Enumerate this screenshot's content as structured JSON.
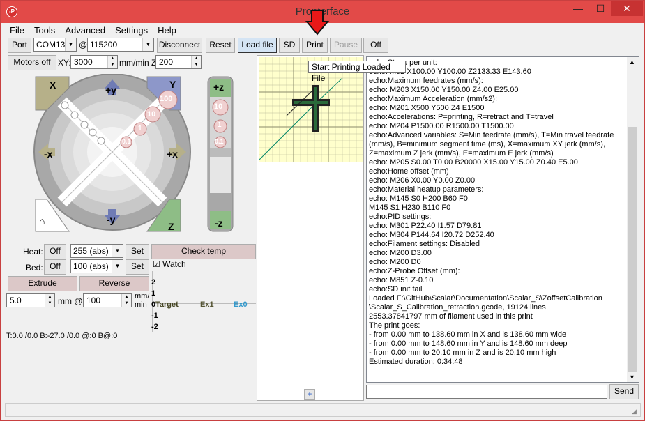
{
  "window": {
    "title": "Pronterface",
    "icon_text": "-P",
    "min": "—",
    "max": "☐",
    "close": "✕"
  },
  "menu": [
    "File",
    "Tools",
    "Advanced",
    "Settings",
    "Help"
  ],
  "toolbar": {
    "port_label": "Port",
    "port_value": "COM13",
    "at": "@",
    "baud_value": "115200",
    "disconnect": "Disconnect",
    "reset": "Reset",
    "load_file": "Load file",
    "sd": "SD",
    "print": "Print",
    "pause": "Pause",
    "off": "Off"
  },
  "tooltip": "Start Printing Loaded File",
  "motor": {
    "motors_off": "Motors off",
    "xy_label": "XY:",
    "xy_value": "3000",
    "units_label": "mm/min Z:",
    "z_value": "200"
  },
  "jog": {
    "home_x": "X",
    "home_y": "Y",
    "home_z": "Z",
    "plus_y": "+y",
    "minus_y": "-y",
    "plus_x": "+x",
    "minus_x": "-x",
    "plus_z": "+z",
    "minus_z": "-z",
    "steps": [
      "100",
      "10",
      "1",
      "0.1"
    ],
    "z_steps": [
      "10",
      "1",
      "0.1"
    ]
  },
  "temp": {
    "heat_label": "Heat:",
    "heat_off": "Off",
    "heat_value": "255 (abs)",
    "heat_set": "Set",
    "bed_label": "Bed:",
    "bed_off": "Off",
    "bed_value": "100 (abs)",
    "bed_set": "Set",
    "check_temp": "Check temp",
    "watch": "Watch"
  },
  "extrude": {
    "extrude": "Extrude",
    "reverse": "Reverse",
    "length": "5.0",
    "mm_at": "mm @",
    "speed": "100",
    "units1": "mm/",
    "units2": "min"
  },
  "graph": {
    "ticks": [
      "2",
      "1",
      "0",
      "-1",
      "-2"
    ],
    "target": "Target",
    "ex1": "Ex1",
    "ex0": "Ex0"
  },
  "status_line": "T:0.0 /0.0 B:-27.0 /0.0 @:0 B@:0",
  "console": [
    "echo:Steps per unit:",
    "echo:  M92 X100.00 Y100.00 Z2133.33 E143.60",
    "echo:Maximum feedrates (mm/s):",
    "echo:  M203 X150.00 Y150.00 Z4.00 E25.00",
    "echo:Maximum Acceleration (mm/s2):",
    "echo:  M201 X500 Y500 Z4 E1500",
    "echo:Accelerations: P=printing, R=retract and T=travel",
    "echo:  M204 P1500.00 R1500.00 T1500.00",
    "echo:Advanced variables: S=Min feedrate (mm/s), T=Min travel feedrate",
    "(mm/s), B=minimum segment time (ms), X=maximum XY jerk (mm/s),",
    "Z=maximum Z jerk (mm/s),  E=maximum E jerk (mm/s)",
    "echo:  M205 S0.00 T0.00 B20000 X15.00 Y15.00 Z0.40 E5.00",
    "echo:Home offset (mm)",
    "echo:  M206 X0.00 Y0.00 Z0.00",
    "echo:Material heatup parameters:",
    "echo:  M145 S0 H200 B60 F0",
    "  M145 S1 H230 B110 F0",
    "echo:PID settings:",
    "echo:  M301 P22.40 I1.57 D79.81",
    "echo:  M304 P144.64 I20.72 D252.40",
    "echo:Filament settings: Disabled",
    "echo:  M200 D3.00",
    "echo:  M200 D0",
    "echo:Z-Probe Offset (mm):",
    "echo:  M851 Z-0.10",
    "echo:SD init fail",
    "Loaded F:\\GitHub\\Scalar\\Documentation\\Scalar_S\\ZoffsetCalibration",
    "\\Scalar_S_Calibration_retraction.gcode, 19124 lines",
    "2553.37841797 mm of filament used in this print",
    "The print goes:",
    "- from 0.00 mm to 138.60 mm in X and is 138.60 mm wide",
    "- from 0.00 mm to 148.60 mm in Y and is 148.60 mm deep",
    "- from 0.00 mm to 20.10 mm in Z and is 20.10 mm high",
    "Estimated duration: 0:34:48"
  ],
  "send": "Send",
  "preview_plus": "+"
}
